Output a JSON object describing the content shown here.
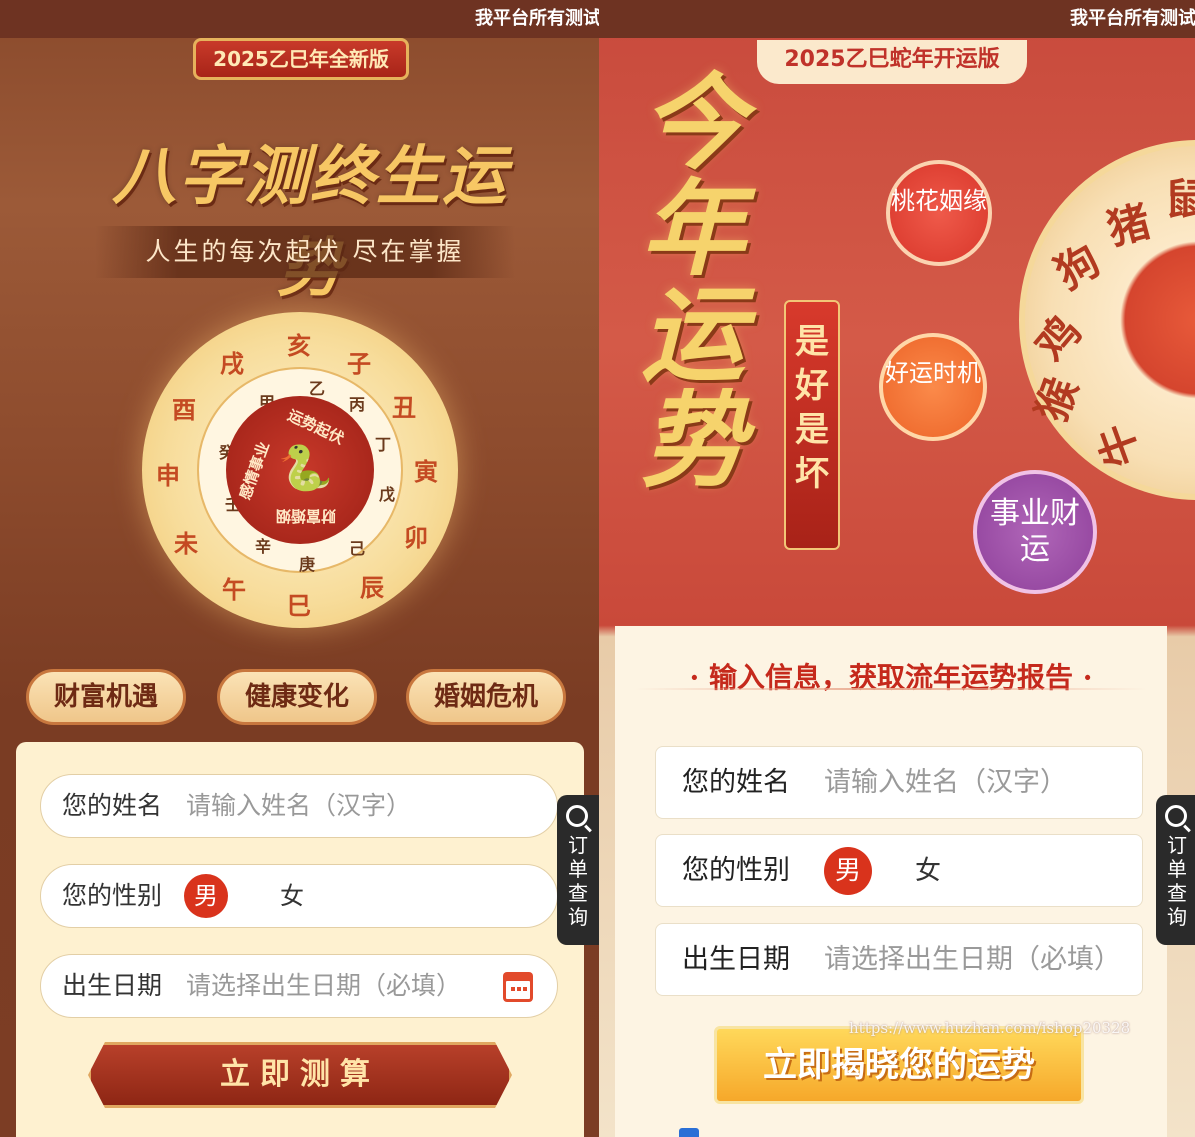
{
  "left": {
    "topbar_text": "我平台所有测试",
    "badge": "2025乙巳年全新版",
    "title": "八字测终生运势",
    "subtitle": "人生的每次起伏 尽在掌握",
    "wheel": {
      "outer": [
        "亥",
        "子",
        "丑",
        "寅",
        "卯",
        "辰",
        "巳",
        "午",
        "未",
        "申",
        "酉",
        "戌"
      ],
      "inner": [
        "乙",
        "丙",
        "丁",
        "戊",
        "己",
        "庚",
        "辛",
        "壬",
        "癸",
        "甲"
      ],
      "core": [
        "运势起伏",
        "财富婚姻",
        "感情事业"
      ]
    },
    "pills": [
      "财富机遇",
      "健康变化",
      "婚姻危机"
    ],
    "form": {
      "name_label": "您的姓名",
      "name_placeholder": "请输入姓名（汉字）",
      "gender_label": "您的性别",
      "gender_male": "男",
      "gender_female": "女",
      "birth_label": "出生日期",
      "birth_placeholder": "请选择出生日期（必填）",
      "submit": "立即测算"
    },
    "side_tab": "订单查询"
  },
  "right": {
    "topbar_text": "我平台所有测试",
    "badge": "2025乙巳蛇年开运版",
    "title": "今年运势",
    "tag": "是好是坏",
    "bubbles": [
      "桃花姻缘",
      "好运时机",
      "事业财运"
    ],
    "wheel_glyphs": [
      "狗",
      "猪",
      "鼠",
      "鸡",
      "猴",
      "牛"
    ],
    "card": {
      "heading": "· 输入信息，获取流年运势报告 ·",
      "name_label": "您的姓名",
      "name_placeholder": "请输入姓名（汉字）",
      "gender_label": "您的性别",
      "gender_male": "男",
      "gender_female": "女",
      "birth_label": "出生日期",
      "birth_placeholder": "请选择出生日期（必填）",
      "submit": "立即揭晓您的运势"
    },
    "watermark": "https://www.huzhan.com/ishop20328",
    "side_tab": "订单查询"
  }
}
